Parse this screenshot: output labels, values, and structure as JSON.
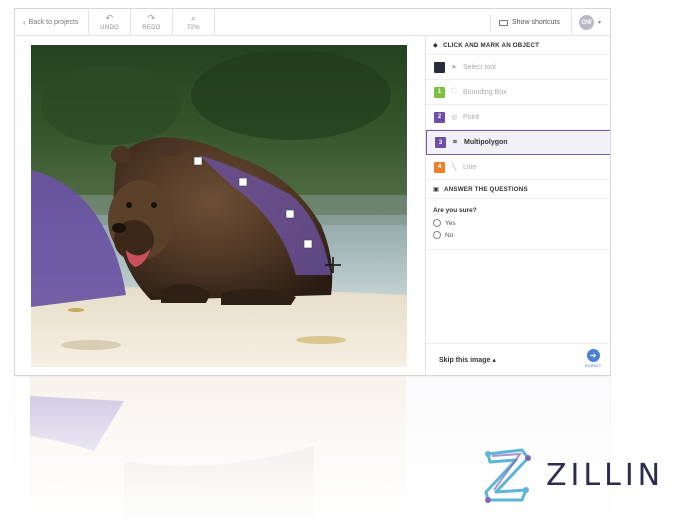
{
  "toolbar": {
    "back_label": "Back to projects",
    "undo_label": "UNDO",
    "redo_label": "REDO",
    "zoom_label": "72%",
    "shortcuts_label": "Show shortcuts",
    "user_initials": "OW"
  },
  "panel": {
    "object_section_title": "CLICK AND MARK AN OBJECT",
    "tools": [
      {
        "key": "",
        "label": "Select tool",
        "color": "#2b2b3d"
      },
      {
        "key": "1",
        "label": "Bounding Box",
        "color": "#7cc141"
      },
      {
        "key": "2",
        "label": "Point",
        "color": "#6d4fa8"
      },
      {
        "key": "3",
        "label": "Multipolygon",
        "color": "#6d4fa8"
      },
      {
        "key": "4",
        "label": "Line",
        "color": "#f07f2b"
      }
    ],
    "questions_section_title": "ANSWER THE QUESTIONS",
    "question": "Are you sure?",
    "options": [
      "Yes",
      "No"
    ],
    "skip_label": "Skip this image",
    "submit_label": "SUBMIT"
  },
  "brand": {
    "name": "ZILLIN"
  },
  "colors": {
    "accent": "#6d4fa8",
    "selection": "#7c5aa6",
    "submit": "#4a7fd6"
  }
}
